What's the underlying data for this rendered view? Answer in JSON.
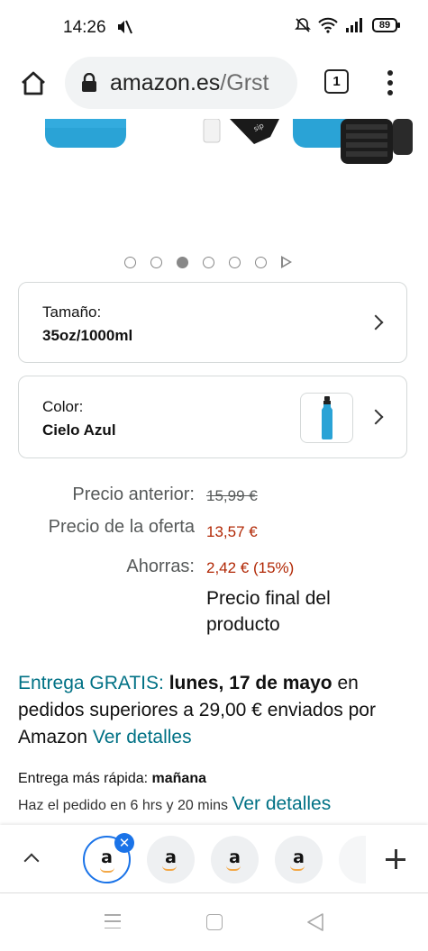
{
  "status_bar": {
    "time": "14:26",
    "battery": "89"
  },
  "browser": {
    "url_host": "amazon.es",
    "url_path": "/Grst",
    "tab_count": "1"
  },
  "carousel": {
    "count": 6,
    "active_index": 2
  },
  "size_selector": {
    "label": "Tamaño:",
    "value": "35oz/1000ml"
  },
  "color_selector": {
    "label": "Color:",
    "value": "Cielo Azul"
  },
  "price": {
    "previous_label": "Precio anterior:",
    "previous_value": "15,99 €",
    "offer_label": "Precio de la oferta",
    "offer_value": "13,57 €",
    "savings_label": "Ahorras:",
    "savings_value": "2,42 € (15%)",
    "final_note": "Precio final del producto"
  },
  "delivery": {
    "free_label": "Entrega GRATIS:",
    "date": "lunes, 17 de mayo",
    "text": " en pedidos superiores a 29,00 € enviados por Amazon ",
    "details_link": "Ver detalles"
  },
  "fast_delivery": {
    "label": "Entrega más rápida:",
    "value": "mañana",
    "order_text": "Haz el pedido en 6 hrs y 20 mins",
    "details_link": "Ver detalles"
  },
  "tab_strip": {
    "tab_glyph": "a"
  },
  "colors": {
    "accent_teal": "#007185",
    "price_red": "#b12704",
    "chrome_blue": "#1a73e8",
    "bottle_blue": "#2aa3d6"
  }
}
